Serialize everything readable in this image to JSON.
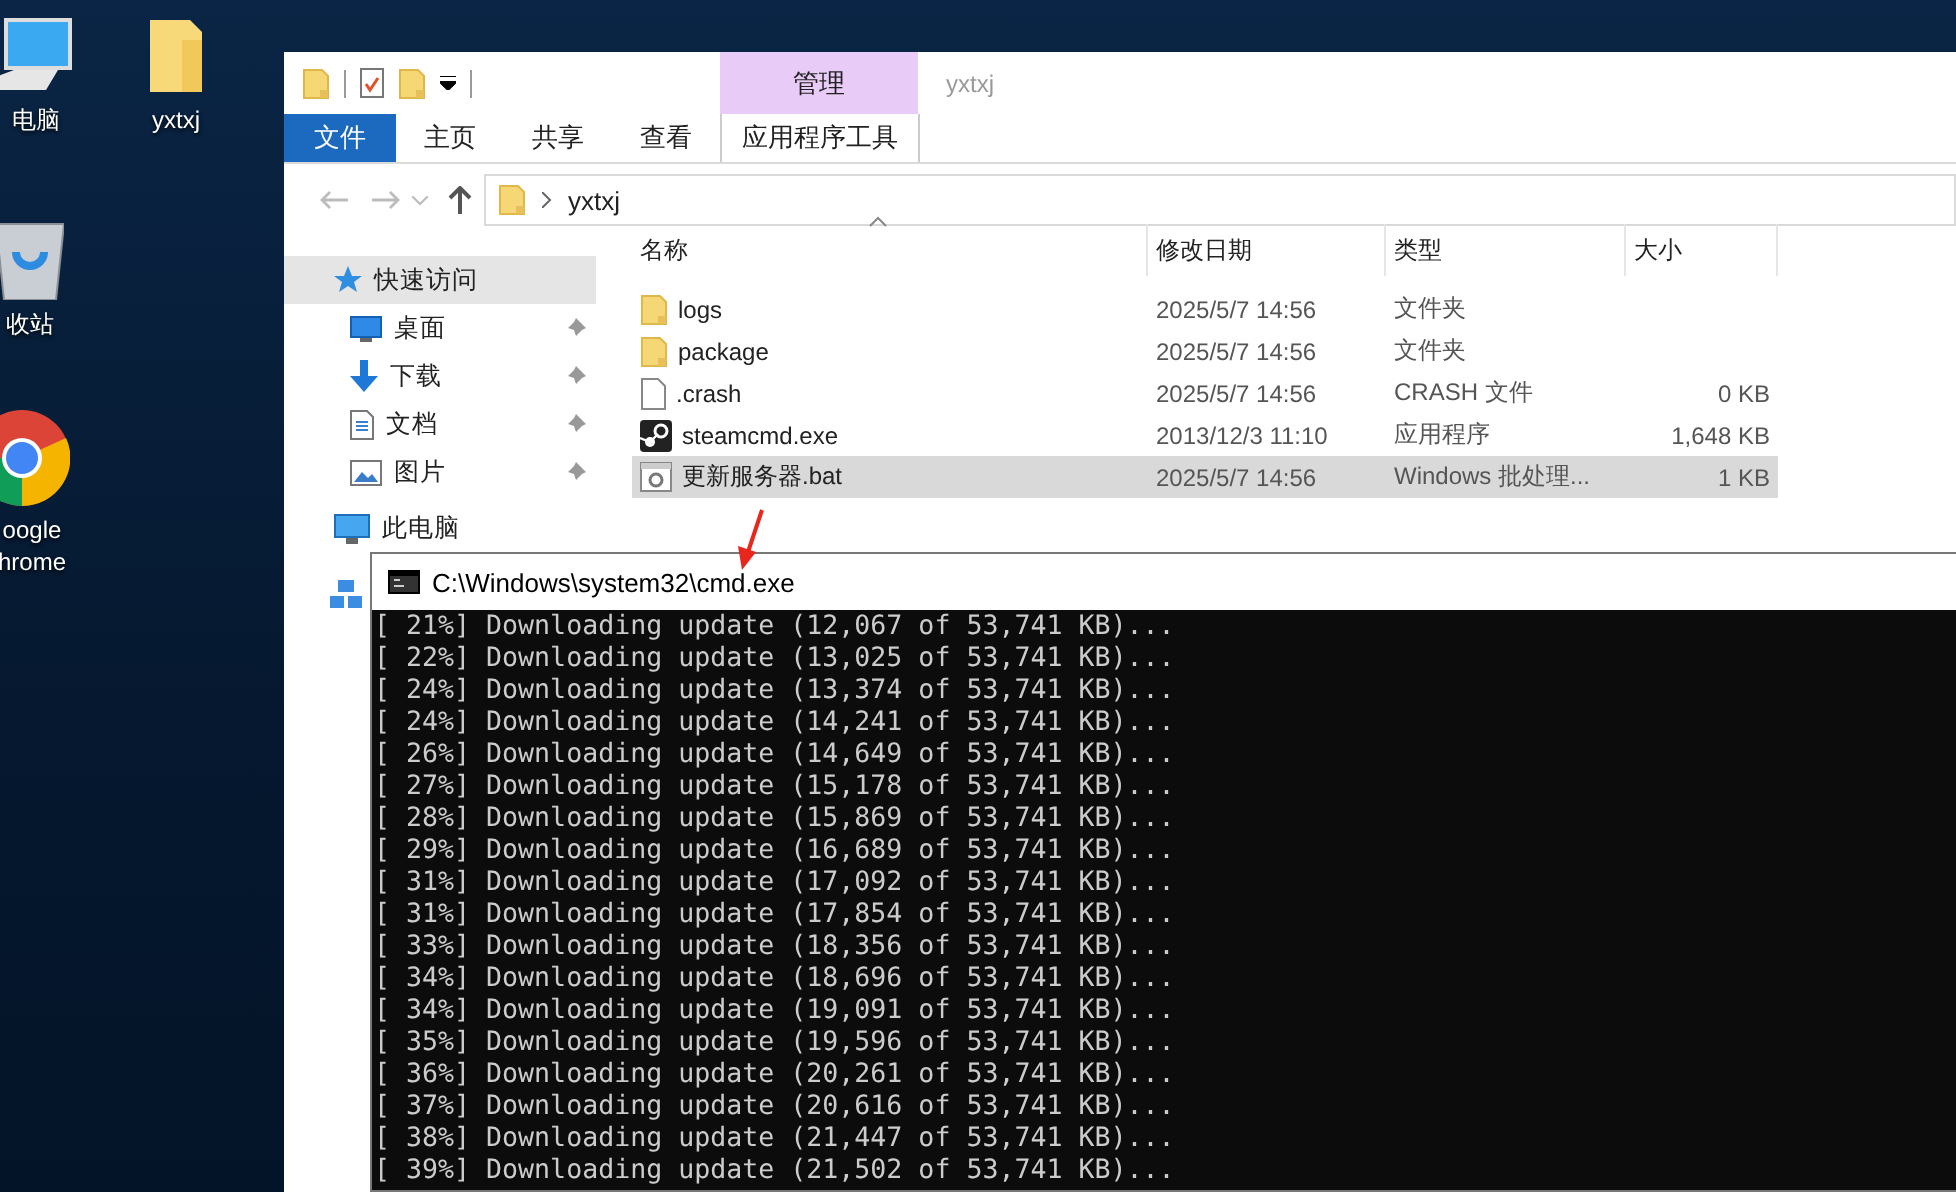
{
  "desktop_icons": [
    {
      "kind": "computer",
      "lines": [
        "电脑"
      ]
    },
    {
      "kind": "folder",
      "lines": [
        "yxtxj"
      ]
    },
    {
      "kind": "recycle",
      "lines": [
        "收站"
      ]
    },
    {
      "kind": "chrome",
      "lines": [
        "oogle",
        "hrome"
      ]
    }
  ],
  "explorer": {
    "context_group": "管理",
    "title": "yxtxj",
    "tabs": [
      {
        "label": "文件",
        "kind": "file"
      },
      {
        "label": "主页",
        "kind": "tab"
      },
      {
        "label": "共享",
        "kind": "tab"
      },
      {
        "label": "查看",
        "kind": "tab"
      },
      {
        "label": "应用程序工具",
        "kind": "context"
      }
    ],
    "address": {
      "path": [
        "yxtxj"
      ]
    },
    "sidebar": {
      "items": [
        {
          "label": "快速访问",
          "kind": "star",
          "selected": true,
          "pinned": false
        },
        {
          "label": "桌面",
          "kind": "desktop",
          "selected": false,
          "pinned": true
        },
        {
          "label": "下载",
          "kind": "download",
          "selected": false,
          "pinned": true
        },
        {
          "label": "文档",
          "kind": "document",
          "selected": false,
          "pinned": true
        },
        {
          "label": "图片",
          "kind": "pictures",
          "selected": false,
          "pinned": true
        },
        {
          "label": "此电脑",
          "kind": "pc",
          "selected": false,
          "pinned": false
        }
      ]
    },
    "table": {
      "columns": [
        {
          "label": "名称",
          "sorted": true
        },
        {
          "label": "修改日期",
          "sorted": false
        },
        {
          "label": "类型",
          "sorted": false
        },
        {
          "label": "大小",
          "sorted": false
        }
      ],
      "rows": [
        {
          "kind": "folder",
          "name": "logs",
          "date": "2025/5/7 14:56",
          "type": "文件夹",
          "selected": false
        },
        {
          "kind": "folder",
          "name": "package",
          "date": "2025/5/7 14:56",
          "type": "文件夹",
          "selected": false
        },
        {
          "kind": "file",
          "name": ".crash",
          "date": "2025/5/7 14:56",
          "type": "CRASH 文件",
          "size": "0 KB",
          "selected": false
        },
        {
          "kind": "steam",
          "name": "steamcmd.exe",
          "date": "2013/12/3 11:10",
          "type": "应用程序",
          "size": "1,648 KB",
          "selected": false
        },
        {
          "kind": "batch",
          "name": "更新服务器.bat",
          "date": "2025/5/7 14:56",
          "type": "Windows 批处理...",
          "size": "1 KB",
          "selected": true
        }
      ]
    }
  },
  "console": {
    "title": "C:\\Windows\\system32\\cmd.exe",
    "lines": [
      "[ 21%] Downloading update (12,067 of 53,741 KB)...",
      "[ 22%] Downloading update (13,025 of 53,741 KB)...",
      "[ 24%] Downloading update (13,374 of 53,741 KB)...",
      "[ 24%] Downloading update (14,241 of 53,741 KB)...",
      "[ 26%] Downloading update (14,649 of 53,741 KB)...",
      "[ 27%] Downloading update (15,178 of 53,741 KB)...",
      "[ 28%] Downloading update (15,869 of 53,741 KB)...",
      "[ 29%] Downloading update (16,689 of 53,741 KB)...",
      "[ 31%] Downloading update (17,092 of 53,741 KB)...",
      "[ 31%] Downloading update (17,854 of 53,741 KB)...",
      "[ 33%] Downloading update (18,356 of 53,741 KB)...",
      "[ 34%] Downloading update (18,696 of 53,741 KB)...",
      "[ 34%] Downloading update (19,091 of 53,741 KB)...",
      "[ 35%] Downloading update (19,596 of 53,741 KB)...",
      "[ 36%] Downloading update (20,261 of 53,741 KB)...",
      "[ 37%] Downloading update (20,616 of 53,741 KB)...",
      "[ 38%] Downloading update (21,447 of 53,741 KB)...",
      "[ 39%] Downloading update (21,502 of 53,741 KB)..."
    ]
  }
}
